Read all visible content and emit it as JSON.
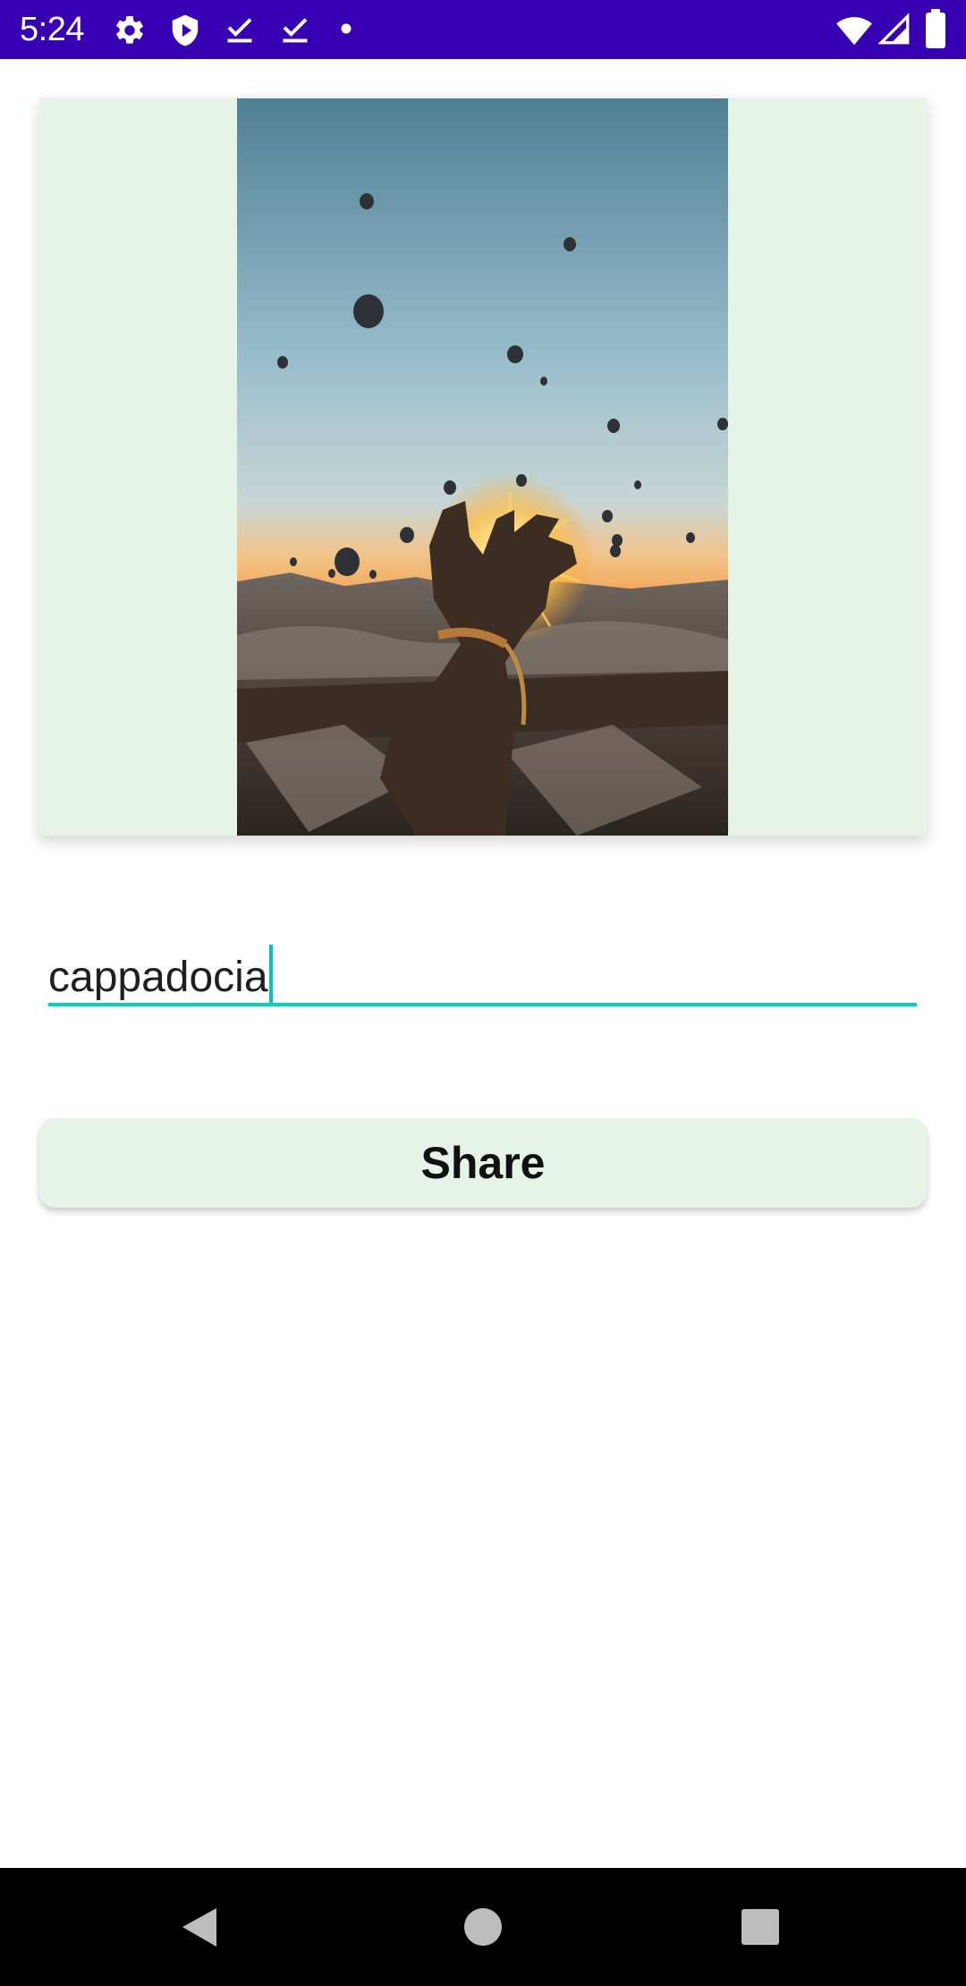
{
  "status_bar": {
    "time": "5:24",
    "left_icons": [
      "gear-icon",
      "shield-play-icon",
      "download-done-icon",
      "download-done-icon",
      "dot-icon"
    ],
    "right_icons": [
      "wifi-icon",
      "cellular-signal-icon",
      "battery-icon"
    ],
    "background_color": "#3700b3"
  },
  "image_card": {
    "image_semantic": "photo of a hand reaching toward the sunrise with hot air balloons over Cappadocia",
    "background_color": "#e6f4e8"
  },
  "text_field": {
    "value": "cappadocia",
    "accent_color": "#03d3bd"
  },
  "share_button": {
    "label": "Share"
  },
  "nav_bar": {
    "buttons": [
      "back-icon",
      "home-icon",
      "recents-icon"
    ]
  }
}
